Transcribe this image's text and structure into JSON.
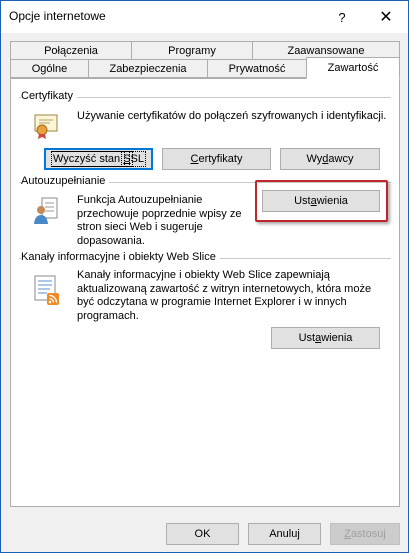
{
  "window": {
    "title": "Opcje internetowe",
    "help_glyph": "?",
    "close_glyph": "✕"
  },
  "tabs": {
    "back": [
      "Połączenia",
      "Programy",
      "Zaawansowane"
    ],
    "front": [
      "Ogólne",
      "Zabezpieczenia",
      "Prywatność",
      "Zawartość"
    ],
    "active": "Zawartość"
  },
  "certificates": {
    "section_title": "Certyfikaty",
    "description": "Używanie certyfikatów do połączeń szyfrowanych i identyfikacji.",
    "clear_ssl": {
      "pre": "Wyczyść stan ",
      "mnemonic": "S",
      "post": "SL"
    },
    "certs": {
      "pre": "",
      "mnemonic": "C",
      "post": "ertyfikaty"
    },
    "publishers": {
      "pre": "Wy",
      "mnemonic": "d",
      "post": "awcy"
    }
  },
  "autocomplete": {
    "section_title": "Autouzupełnianie",
    "description": "Funkcja Autouzupełnianie przechowuje poprzednie wpisy ze stron sieci Web i sugeruje dopasowania.",
    "settings": {
      "pre": "Ust",
      "mnemonic": "a",
      "post": "wienia"
    }
  },
  "feeds": {
    "section_title": "Kanały informacyjne i obiekty Web Slice",
    "description": "Kanały informacyjne i obiekty Web Slice zapewniają aktualizowaną zawartość z witryn internetowych, która może być odczytana w programie Internet Explorer i w innych programach.",
    "settings": {
      "pre": "Ust",
      "mnemonic": "a",
      "post": "wienia"
    }
  },
  "footer": {
    "ok": "OK",
    "cancel": "Anuluj",
    "apply": {
      "pre": "",
      "mnemonic": "Z",
      "post": "astosuj"
    }
  },
  "colors": {
    "accent": "#0078d7",
    "highlight": "#c0262d"
  }
}
